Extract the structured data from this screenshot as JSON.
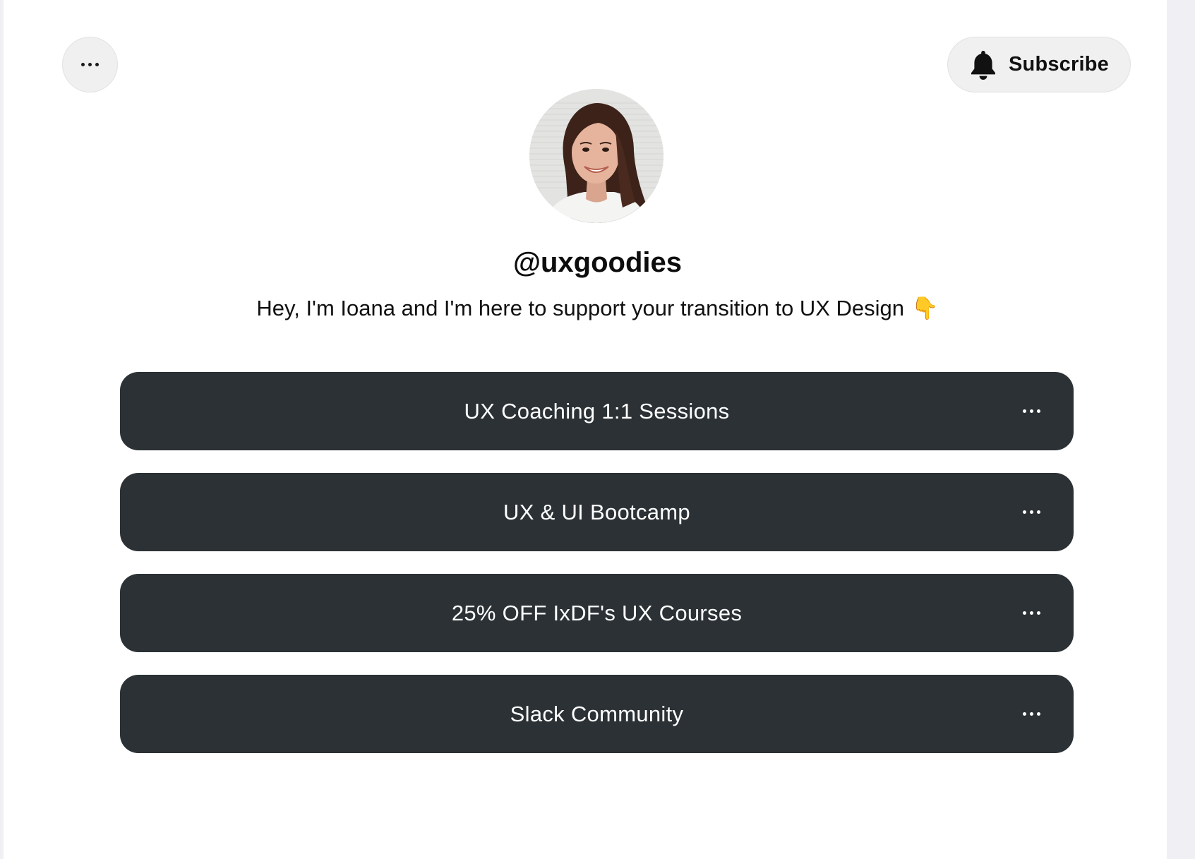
{
  "header": {
    "more_icon": "ellipsis-icon",
    "subscribe": {
      "icon": "bell-icon",
      "label": "Subscribe"
    }
  },
  "profile": {
    "handle": "@uxgoodies",
    "bio": "Hey, I'm Ioana and I'm here to support your transition to UX Design",
    "bio_emoji": "👇"
  },
  "links": [
    {
      "label": "UX Coaching 1:1 Sessions",
      "more_icon": "ellipsis-icon"
    },
    {
      "label": "UX & UI Bootcamp",
      "more_icon": "ellipsis-icon"
    },
    {
      "label": "25% OFF IxDF's UX Courses",
      "more_icon": "ellipsis-icon"
    },
    {
      "label": "Slack Community",
      "more_icon": "ellipsis-icon"
    }
  ],
  "colors": {
    "page_background": "#ffffff",
    "outer_background": "#f0eff4",
    "link_button": "#2b3135",
    "link_text": "#ffffff",
    "pill_button": "#f0f0f0"
  }
}
